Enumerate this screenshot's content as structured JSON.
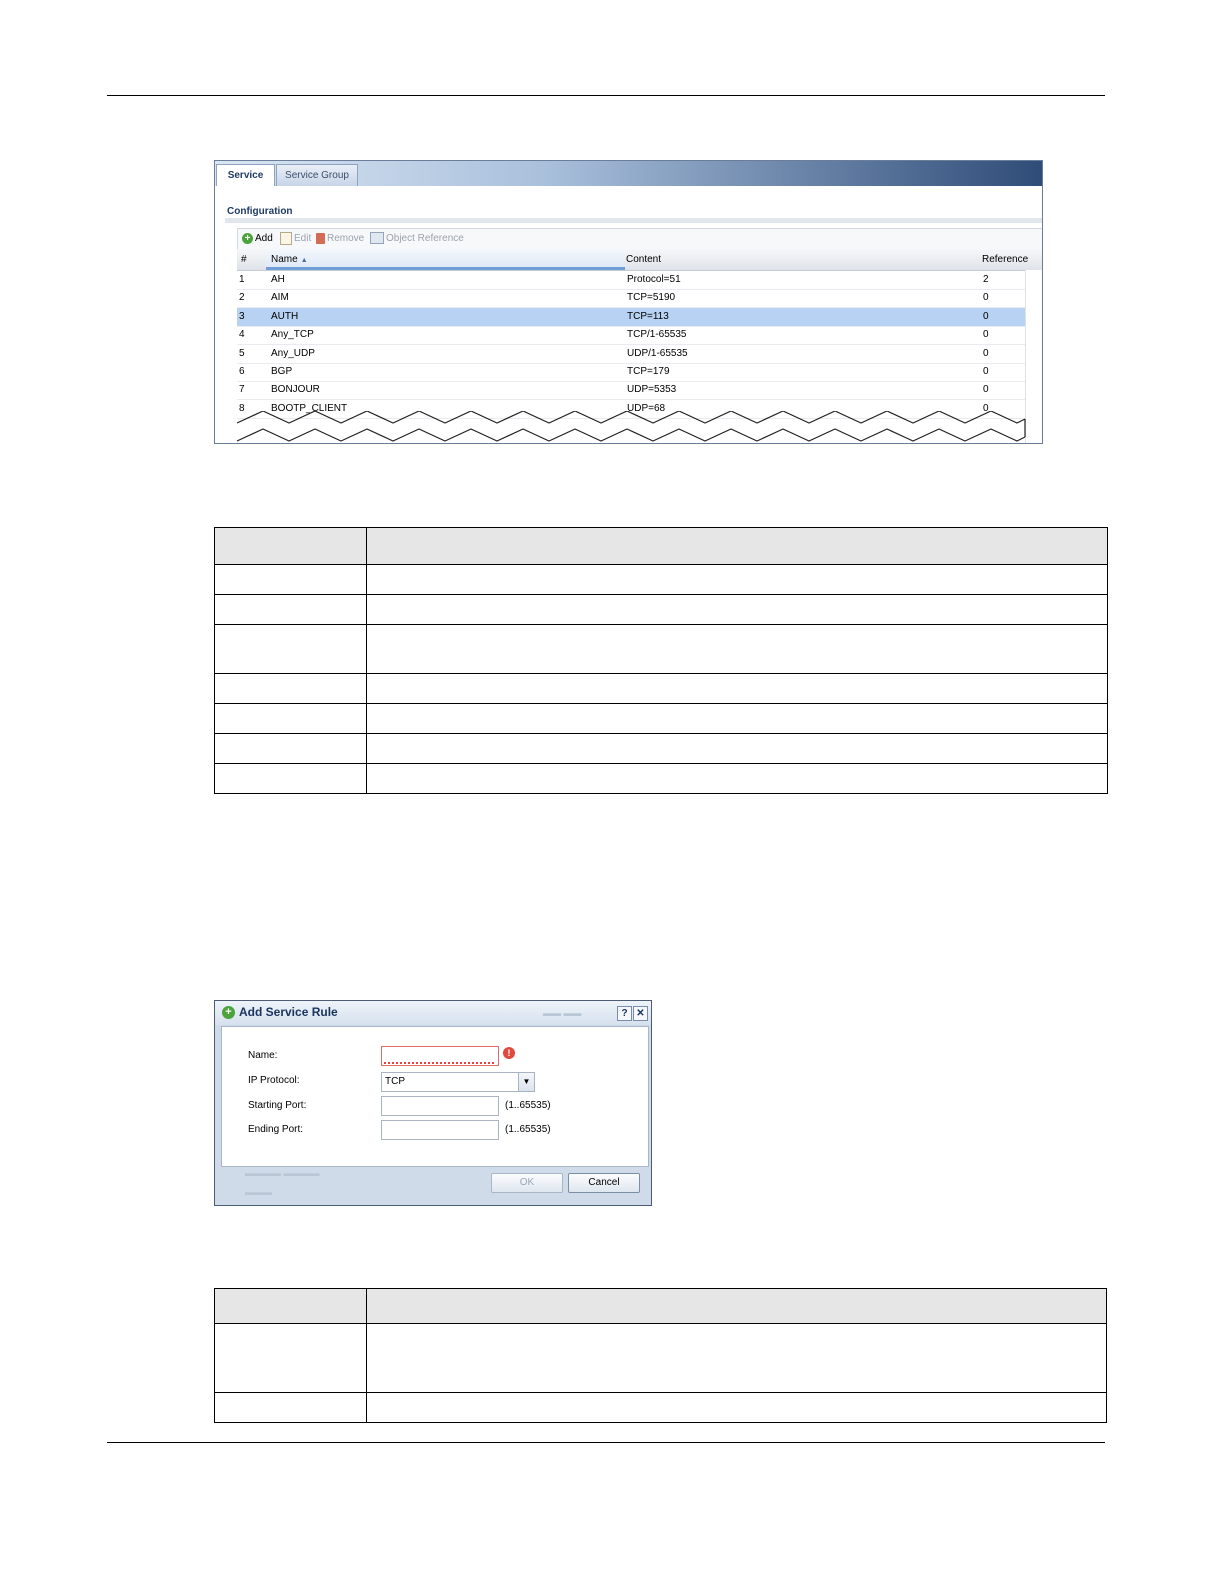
{
  "service_screen": {
    "tabs": [
      {
        "label": "Service",
        "active": true
      },
      {
        "label": "Service Group",
        "active": false
      }
    ],
    "section_title": "Configuration",
    "toolbar": {
      "add": "Add",
      "edit": "Edit",
      "remove": "Remove",
      "object_reference": "Object Reference"
    },
    "columns": [
      "#",
      "Name",
      "Content",
      "Reference"
    ],
    "rows": [
      {
        "idx": "1",
        "name": "AH",
        "content": "Protocol=51",
        "ref": "2"
      },
      {
        "idx": "2",
        "name": "AIM",
        "content": "TCP=5190",
        "ref": "0"
      },
      {
        "idx": "3",
        "name": "AUTH",
        "content": "TCP=113",
        "ref": "0",
        "selected": true
      },
      {
        "idx": "4",
        "name": "Any_TCP",
        "content": "TCP/1-65535",
        "ref": "0"
      },
      {
        "idx": "5",
        "name": "Any_UDP",
        "content": "UDP/1-65535",
        "ref": "0"
      },
      {
        "idx": "6",
        "name": "BGP",
        "content": "TCP=179",
        "ref": "0"
      },
      {
        "idx": "7",
        "name": "BONJOUR",
        "content": "UDP=5353",
        "ref": "0"
      },
      {
        "idx": "8",
        "name": "BOOTP_CLIENT",
        "content": "UDP=68",
        "ref": "0"
      }
    ]
  },
  "dialog": {
    "title": "Add Service Rule",
    "fields": {
      "name_label": "Name:",
      "ip_protocol_label": "IP Protocol:",
      "ip_protocol_value": "TCP",
      "starting_port_label": "Starting Port:",
      "ending_port_label": "Ending Port:",
      "port_range_hint": "(1..65535)"
    },
    "buttons": {
      "ok": "OK",
      "cancel": "Cancel"
    },
    "help_glyph": "?",
    "close_glyph": "✕"
  },
  "colors": {
    "selected_row": "#b7d2f2",
    "tab_gradient_end": "#2f4c78",
    "header_fill": "#e6e6e6"
  }
}
